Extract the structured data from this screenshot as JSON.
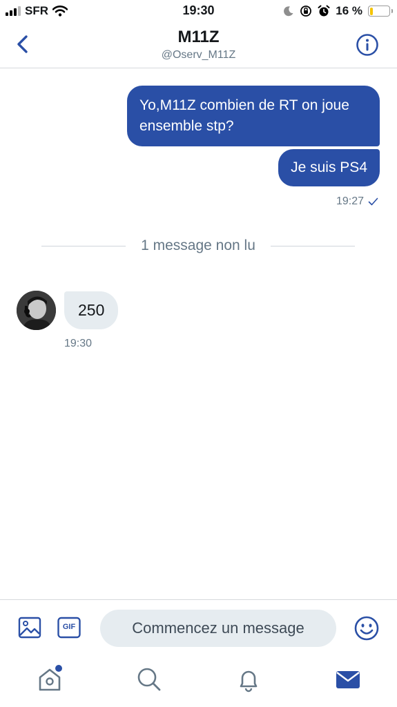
{
  "status_bar": {
    "carrier": "SFR",
    "time": "19:30",
    "battery_percent": "16 %",
    "battery_level": 0.16,
    "icons": [
      "signal-icon",
      "wifi-icon",
      "moon-icon",
      "rotation-lock-icon",
      "alarm-icon",
      "battery-icon"
    ]
  },
  "header": {
    "title": "M11Z",
    "handle": "@Oserv_M11Z",
    "icons": [
      "back-chevron-icon",
      "info-icon"
    ]
  },
  "messages": {
    "outgoing": [
      {
        "text": "Yo,M11Z combien de RT on joue ensemble stp?"
      },
      {
        "text": "Je suis PS4"
      }
    ],
    "outgoing_time": "19:27",
    "unread_divider": "1 message non lu",
    "incoming": [
      {
        "text": "250"
      }
    ],
    "incoming_time": "19:30"
  },
  "composer": {
    "placeholder": "Commencez un message",
    "gif_label": "GIF",
    "icons": [
      "image-icon",
      "gif-icon",
      "emoji-icon"
    ]
  },
  "tabbar": {
    "items": [
      "home-icon",
      "search-icon",
      "notifications-icon",
      "messages-icon"
    ],
    "active": "messages-icon",
    "home_has_badge": true
  },
  "colors": {
    "accent": "#2a4fa6",
    "incoming_bubble": "#e6ecf0",
    "secondary_text": "#657786",
    "battery_fill": "#f5c400"
  }
}
